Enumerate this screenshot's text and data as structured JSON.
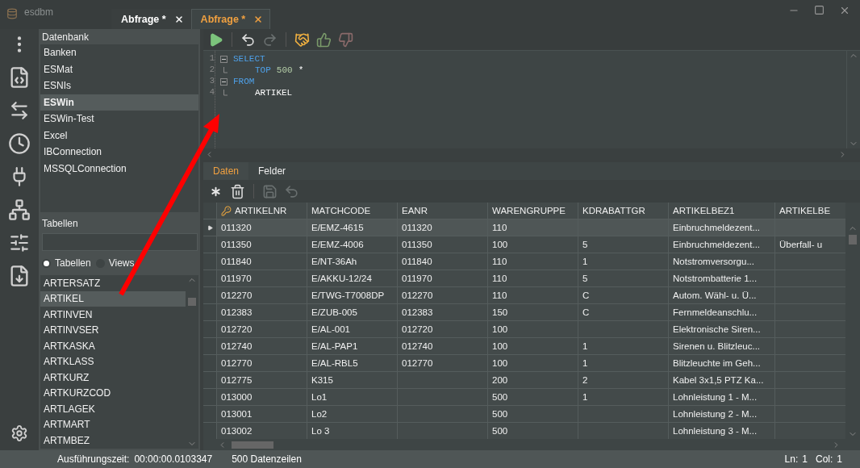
{
  "window": {
    "app_name": "esdbm",
    "tabs": [
      {
        "label": "Abfrage *",
        "selected": false
      },
      {
        "label": "Abfrage *",
        "selected": true
      }
    ]
  },
  "database_panel": {
    "title": "Datenbank",
    "items": [
      {
        "label": "Banken",
        "selected": false
      },
      {
        "label": "ESMat",
        "selected": false
      },
      {
        "label": "ESNIs",
        "selected": false
      },
      {
        "label": "ESWin",
        "selected": true
      },
      {
        "label": "ESWin-Test",
        "selected": false
      },
      {
        "label": "Excel",
        "selected": false
      },
      {
        "label": "IBConnection",
        "selected": false
      },
      {
        "label": "MSSQLConnection",
        "selected": false
      }
    ]
  },
  "tables_panel": {
    "title": "Tabellen",
    "filter": [
      {
        "label": "Tabellen",
        "selected": true
      },
      {
        "label": "Views",
        "selected": false
      }
    ],
    "items": [
      {
        "label": "ARTERSATZ",
        "selected": false
      },
      {
        "label": "ARTIKEL",
        "selected": true
      },
      {
        "label": "ARTINVEN",
        "selected": false
      },
      {
        "label": "ARTINVSER",
        "selected": false
      },
      {
        "label": "ARTKASKA",
        "selected": false
      },
      {
        "label": "ARTKLASS",
        "selected": false
      },
      {
        "label": "ARTKURZ",
        "selected": false
      },
      {
        "label": "ARTKURZCOD",
        "selected": false
      },
      {
        "label": "ARTLAGEK",
        "selected": false
      },
      {
        "label": "ARTMART",
        "selected": false
      },
      {
        "label": "ARTMBEZ",
        "selected": false
      }
    ]
  },
  "editor_toolbar": [
    {
      "kind": "run",
      "disabled": false
    },
    {
      "kind": "undo",
      "disabled": false
    },
    {
      "kind": "redo",
      "disabled": true
    },
    {
      "kind": "handshake",
      "disabled": false
    },
    {
      "kind": "thumbs_up",
      "disabled": false
    },
    {
      "kind": "thumbs_down",
      "disabled": false
    }
  ],
  "editor": {
    "clauses": [
      {
        "number": "1",
        "keyword": "SELECT",
        "children": [
          {
            "number": "2",
            "tokens": [
              {
                "text": "TOP",
                "kind": "keyword"
              },
              {
                "text": "500",
                "kind": "number"
              },
              {
                "text": "*",
                "kind": "plain"
              }
            ]
          }
        ]
      },
      {
        "number": "3",
        "keyword": "FROM",
        "children": [
          {
            "number": "4",
            "tokens": [
              {
                "text": "ARTIKEL",
                "kind": "plain"
              }
            ]
          }
        ]
      }
    ]
  },
  "result_tabs": [
    {
      "label": "Daten",
      "selected": true
    },
    {
      "label": "Felder",
      "selected": false
    }
  ],
  "grid_toolbar": [
    {
      "kind": "new",
      "disabled": false
    },
    {
      "kind": "delete",
      "disabled": false
    },
    {
      "kind": "save",
      "disabled": true
    },
    {
      "kind": "revert",
      "disabled": true
    }
  ],
  "grid": {
    "columns": [
      {
        "label": "ARTIKELNR",
        "kind": "key"
      },
      {
        "label": "MATCHCODE",
        "kind": "plain"
      },
      {
        "label": "EANR",
        "kind": "plain"
      },
      {
        "label": "WARENGRUPPE",
        "kind": "plain"
      },
      {
        "label": "KDRABATTGR",
        "kind": "plain"
      },
      {
        "label": "ARTIKELBEZ1",
        "kind": "plain"
      },
      {
        "label": "ARTIKELBE",
        "kind": "plain"
      }
    ],
    "rows": [
      {
        "selected": true,
        "cells": [
          "011320",
          "E/EMZ-4615",
          "011320",
          "110",
          "",
          "Einbruchmeldezent...",
          ""
        ]
      },
      {
        "selected": false,
        "cells": [
          "011350",
          "E/EMZ-4006",
          "011350",
          "100",
          "5",
          "Einbruchmeldezent...",
          "Überfall- u"
        ]
      },
      {
        "selected": false,
        "cells": [
          "011840",
          "E/NT-36Ah",
          "011840",
          "110",
          "1",
          "Notstromversorgu...",
          ""
        ]
      },
      {
        "selected": false,
        "cells": [
          "011970",
          "E/AKKU-12/24",
          "011970",
          "110",
          "5",
          "Notstrombatterie 1...",
          ""
        ]
      },
      {
        "selected": false,
        "cells": [
          "012270",
          "E/TWG-T7008DP",
          "012270",
          "110",
          "C",
          "Autom. Wähl- u. Ü...",
          ""
        ]
      },
      {
        "selected": false,
        "cells": [
          "012383",
          "E/ZUB-005",
          "012383",
          "150",
          "C",
          "Fernmeldeanschlu...",
          ""
        ]
      },
      {
        "selected": false,
        "cells": [
          "012720",
          "E/AL-001",
          "012720",
          "100",
          "",
          "Elektronische Siren...",
          ""
        ]
      },
      {
        "selected": false,
        "cells": [
          "012740",
          "E/AL-PAP1",
          "012740",
          "100",
          "1",
          "Sirenen u. Blitzleuc...",
          ""
        ]
      },
      {
        "selected": false,
        "cells": [
          "012770",
          "E/AL-RBL5",
          "012770",
          "100",
          "1",
          "Blitzleuchte im Geh...",
          ""
        ]
      },
      {
        "selected": false,
        "cells": [
          "012775",
          "K315",
          "",
          "200",
          "2",
          "Kabel 3x1,5 PTZ Ka...",
          ""
        ]
      },
      {
        "selected": false,
        "cells": [
          "013000",
          "Lo1",
          "",
          "500",
          "1",
          "Lohnleistung 1 - M...",
          ""
        ]
      },
      {
        "selected": false,
        "cells": [
          "013001",
          "Lo2",
          "",
          "500",
          "",
          "Lohnleistung 2 - M...",
          ""
        ]
      },
      {
        "selected": false,
        "cells": [
          "013002",
          "Lo 3",
          "",
          "500",
          "",
          "Lohnleistung 3 - M...",
          ""
        ]
      }
    ]
  },
  "status_bar": {
    "elapsed_label": "Ausführungszeit:",
    "elapsed": "00:00:00.0103347",
    "row_count": "500 Datenzeilen",
    "line_label": "Ln:",
    "line": "1",
    "column_label": "Col:",
    "column": "1"
  }
}
